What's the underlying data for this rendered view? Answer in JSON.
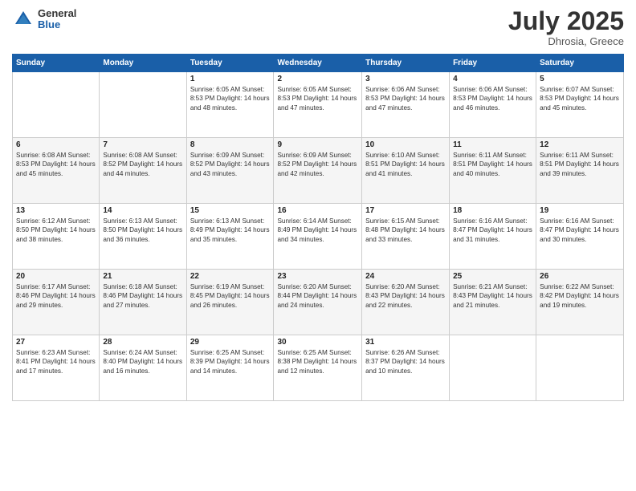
{
  "header": {
    "logo_general": "General",
    "logo_blue": "Blue",
    "title": "July 2025",
    "location": "Dhrosia, Greece"
  },
  "weekdays": [
    "Sunday",
    "Monday",
    "Tuesday",
    "Wednesday",
    "Thursday",
    "Friday",
    "Saturday"
  ],
  "weeks": [
    [
      {
        "day": "",
        "info": ""
      },
      {
        "day": "",
        "info": ""
      },
      {
        "day": "1",
        "info": "Sunrise: 6:05 AM\nSunset: 8:53 PM\nDaylight: 14 hours\nand 48 minutes."
      },
      {
        "day": "2",
        "info": "Sunrise: 6:05 AM\nSunset: 8:53 PM\nDaylight: 14 hours\nand 47 minutes."
      },
      {
        "day": "3",
        "info": "Sunrise: 6:06 AM\nSunset: 8:53 PM\nDaylight: 14 hours\nand 47 minutes."
      },
      {
        "day": "4",
        "info": "Sunrise: 6:06 AM\nSunset: 8:53 PM\nDaylight: 14 hours\nand 46 minutes."
      },
      {
        "day": "5",
        "info": "Sunrise: 6:07 AM\nSunset: 8:53 PM\nDaylight: 14 hours\nand 45 minutes."
      }
    ],
    [
      {
        "day": "6",
        "info": "Sunrise: 6:08 AM\nSunset: 8:53 PM\nDaylight: 14 hours\nand 45 minutes."
      },
      {
        "day": "7",
        "info": "Sunrise: 6:08 AM\nSunset: 8:52 PM\nDaylight: 14 hours\nand 44 minutes."
      },
      {
        "day": "8",
        "info": "Sunrise: 6:09 AM\nSunset: 8:52 PM\nDaylight: 14 hours\nand 43 minutes."
      },
      {
        "day": "9",
        "info": "Sunrise: 6:09 AM\nSunset: 8:52 PM\nDaylight: 14 hours\nand 42 minutes."
      },
      {
        "day": "10",
        "info": "Sunrise: 6:10 AM\nSunset: 8:51 PM\nDaylight: 14 hours\nand 41 minutes."
      },
      {
        "day": "11",
        "info": "Sunrise: 6:11 AM\nSunset: 8:51 PM\nDaylight: 14 hours\nand 40 minutes."
      },
      {
        "day": "12",
        "info": "Sunrise: 6:11 AM\nSunset: 8:51 PM\nDaylight: 14 hours\nand 39 minutes."
      }
    ],
    [
      {
        "day": "13",
        "info": "Sunrise: 6:12 AM\nSunset: 8:50 PM\nDaylight: 14 hours\nand 38 minutes."
      },
      {
        "day": "14",
        "info": "Sunrise: 6:13 AM\nSunset: 8:50 PM\nDaylight: 14 hours\nand 36 minutes."
      },
      {
        "day": "15",
        "info": "Sunrise: 6:13 AM\nSunset: 8:49 PM\nDaylight: 14 hours\nand 35 minutes."
      },
      {
        "day": "16",
        "info": "Sunrise: 6:14 AM\nSunset: 8:49 PM\nDaylight: 14 hours\nand 34 minutes."
      },
      {
        "day": "17",
        "info": "Sunrise: 6:15 AM\nSunset: 8:48 PM\nDaylight: 14 hours\nand 33 minutes."
      },
      {
        "day": "18",
        "info": "Sunrise: 6:16 AM\nSunset: 8:47 PM\nDaylight: 14 hours\nand 31 minutes."
      },
      {
        "day": "19",
        "info": "Sunrise: 6:16 AM\nSunset: 8:47 PM\nDaylight: 14 hours\nand 30 minutes."
      }
    ],
    [
      {
        "day": "20",
        "info": "Sunrise: 6:17 AM\nSunset: 8:46 PM\nDaylight: 14 hours\nand 29 minutes."
      },
      {
        "day": "21",
        "info": "Sunrise: 6:18 AM\nSunset: 8:46 PM\nDaylight: 14 hours\nand 27 minutes."
      },
      {
        "day": "22",
        "info": "Sunrise: 6:19 AM\nSunset: 8:45 PM\nDaylight: 14 hours\nand 26 minutes."
      },
      {
        "day": "23",
        "info": "Sunrise: 6:20 AM\nSunset: 8:44 PM\nDaylight: 14 hours\nand 24 minutes."
      },
      {
        "day": "24",
        "info": "Sunrise: 6:20 AM\nSunset: 8:43 PM\nDaylight: 14 hours\nand 22 minutes."
      },
      {
        "day": "25",
        "info": "Sunrise: 6:21 AM\nSunset: 8:43 PM\nDaylight: 14 hours\nand 21 minutes."
      },
      {
        "day": "26",
        "info": "Sunrise: 6:22 AM\nSunset: 8:42 PM\nDaylight: 14 hours\nand 19 minutes."
      }
    ],
    [
      {
        "day": "27",
        "info": "Sunrise: 6:23 AM\nSunset: 8:41 PM\nDaylight: 14 hours\nand 17 minutes."
      },
      {
        "day": "28",
        "info": "Sunrise: 6:24 AM\nSunset: 8:40 PM\nDaylight: 14 hours\nand 16 minutes."
      },
      {
        "day": "29",
        "info": "Sunrise: 6:25 AM\nSunset: 8:39 PM\nDaylight: 14 hours\nand 14 minutes."
      },
      {
        "day": "30",
        "info": "Sunrise: 6:25 AM\nSunset: 8:38 PM\nDaylight: 14 hours\nand 12 minutes."
      },
      {
        "day": "31",
        "info": "Sunrise: 6:26 AM\nSunset: 8:37 PM\nDaylight: 14 hours\nand 10 minutes."
      },
      {
        "day": "",
        "info": ""
      },
      {
        "day": "",
        "info": ""
      }
    ]
  ]
}
